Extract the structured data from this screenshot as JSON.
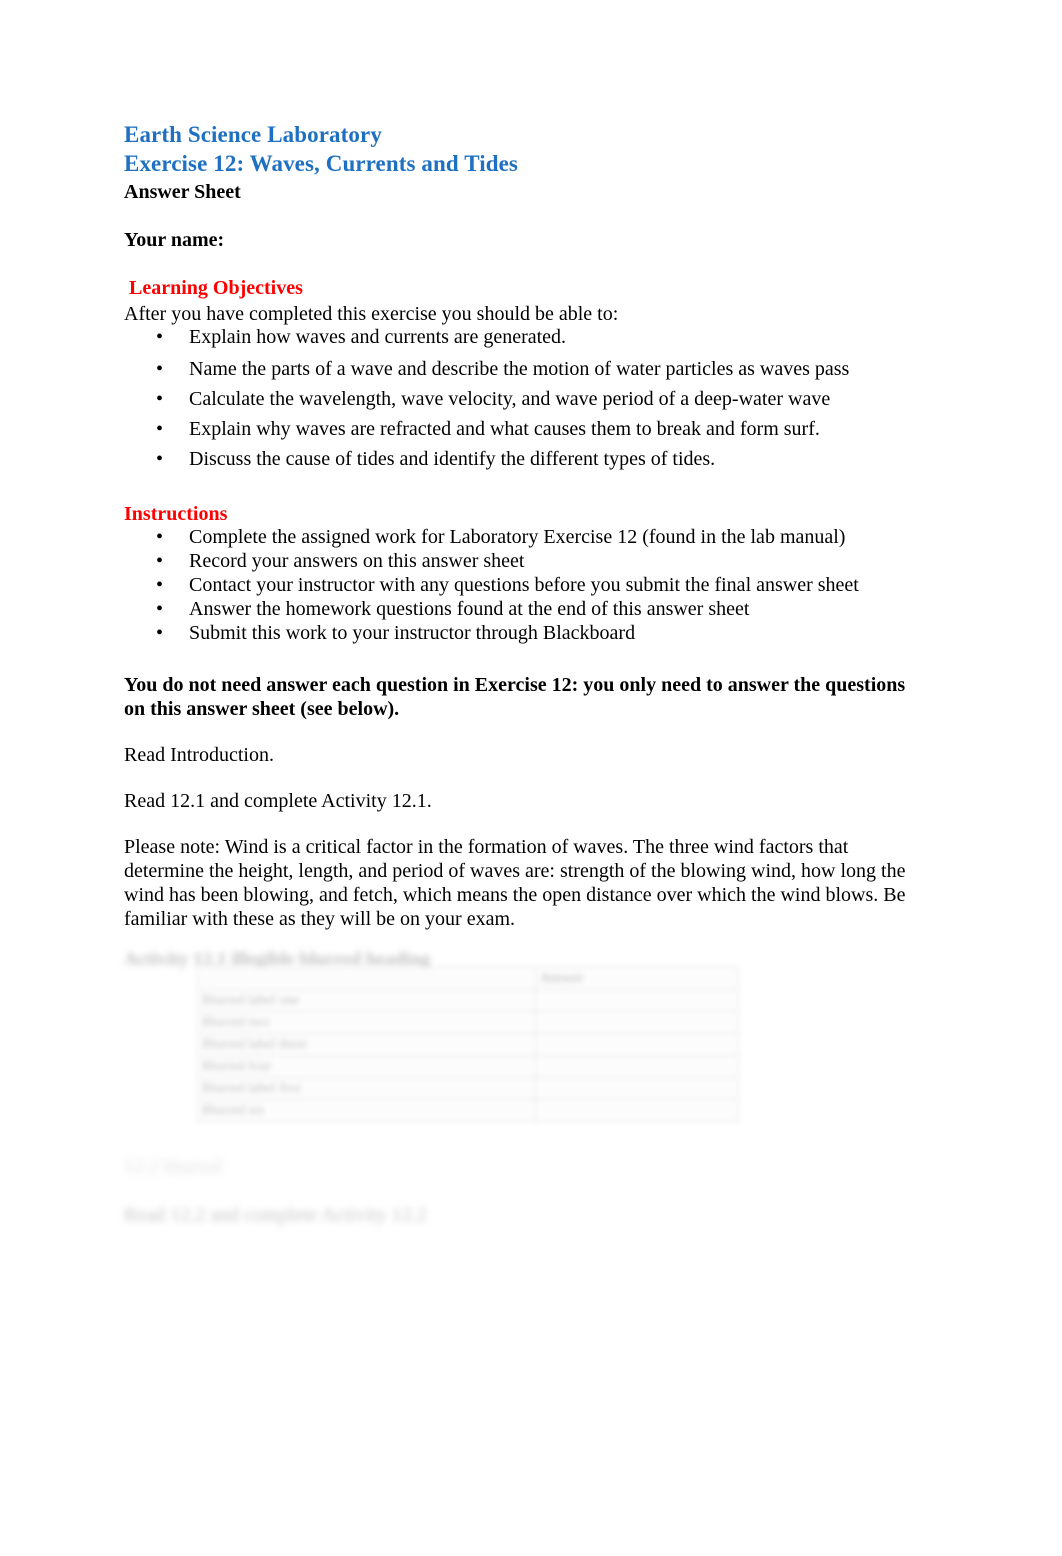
{
  "document": {
    "title": "Earth Science Laboratory",
    "subtitle": "Exercise 12: Waves, Currents and Tides",
    "doc_type": "Answer Sheet",
    "name_label": "Your name:"
  },
  "objectives": {
    "heading": " Learning Objectives",
    "intro": "After you have completed this exercise you should be able to:",
    "items": [
      "Explain how waves and currents are generated.",
      "Name the parts of a wave and describe the motion of water particles as waves pass",
      "Calculate the wavelength, wave velocity, and wave period of a deep-water wave",
      "Explain why waves are refracted and what causes them to break and form surf.",
      "Discuss the cause of tides and identify the different types of tides."
    ]
  },
  "instructions": {
    "heading": "Instructions",
    "items": [
      "Complete the assigned work for Laboratory Exercise 12 (found in the lab manual)",
      "Record your answers on this answer sheet",
      "Contact your instructor with any questions before you submit the final answer sheet",
      "Answer the homework questions found at the end of this answer sheet",
      "Submit this work to your instructor through Blackboard"
    ]
  },
  "body": {
    "notice": "You do not need answer each question in Exercise 12: you only need to answer the questions on this answer sheet (see below).",
    "read_intro": "Read Introduction.",
    "read_activity": "Read 12.1 and complete Activity 12.1.",
    "please_note": "Please note: Wind is a critical factor in the formation of waves. The three wind factors that determine the height, length, and period of waves are: strength of the blowing wind, how long the wind has been blowing, and fetch, which means the open distance over which the wind blows. Be familiar with these as they will be on your exam."
  },
  "obscured": {
    "activity_heading": "Activity 12.1 illegible blurred heading",
    "trailing_heading": "12.2 blurred",
    "trailing_line": "Read 12.2 and complete Activity 12.2"
  },
  "table": {
    "headers": [
      "",
      "Answer"
    ],
    "rows": [
      [
        "Blurred label one",
        ""
      ],
      [
        "Blurred two",
        ""
      ],
      [
        "Blurred label three",
        ""
      ],
      [
        "Blurred four",
        ""
      ],
      [
        "Blurred label five",
        ""
      ],
      [
        "Blurred six",
        ""
      ]
    ]
  },
  "colors": {
    "heading_blue": "#1F70C1",
    "heading_red": "#FF0000",
    "text": "#000000",
    "table_border": "#DCDCDC"
  }
}
